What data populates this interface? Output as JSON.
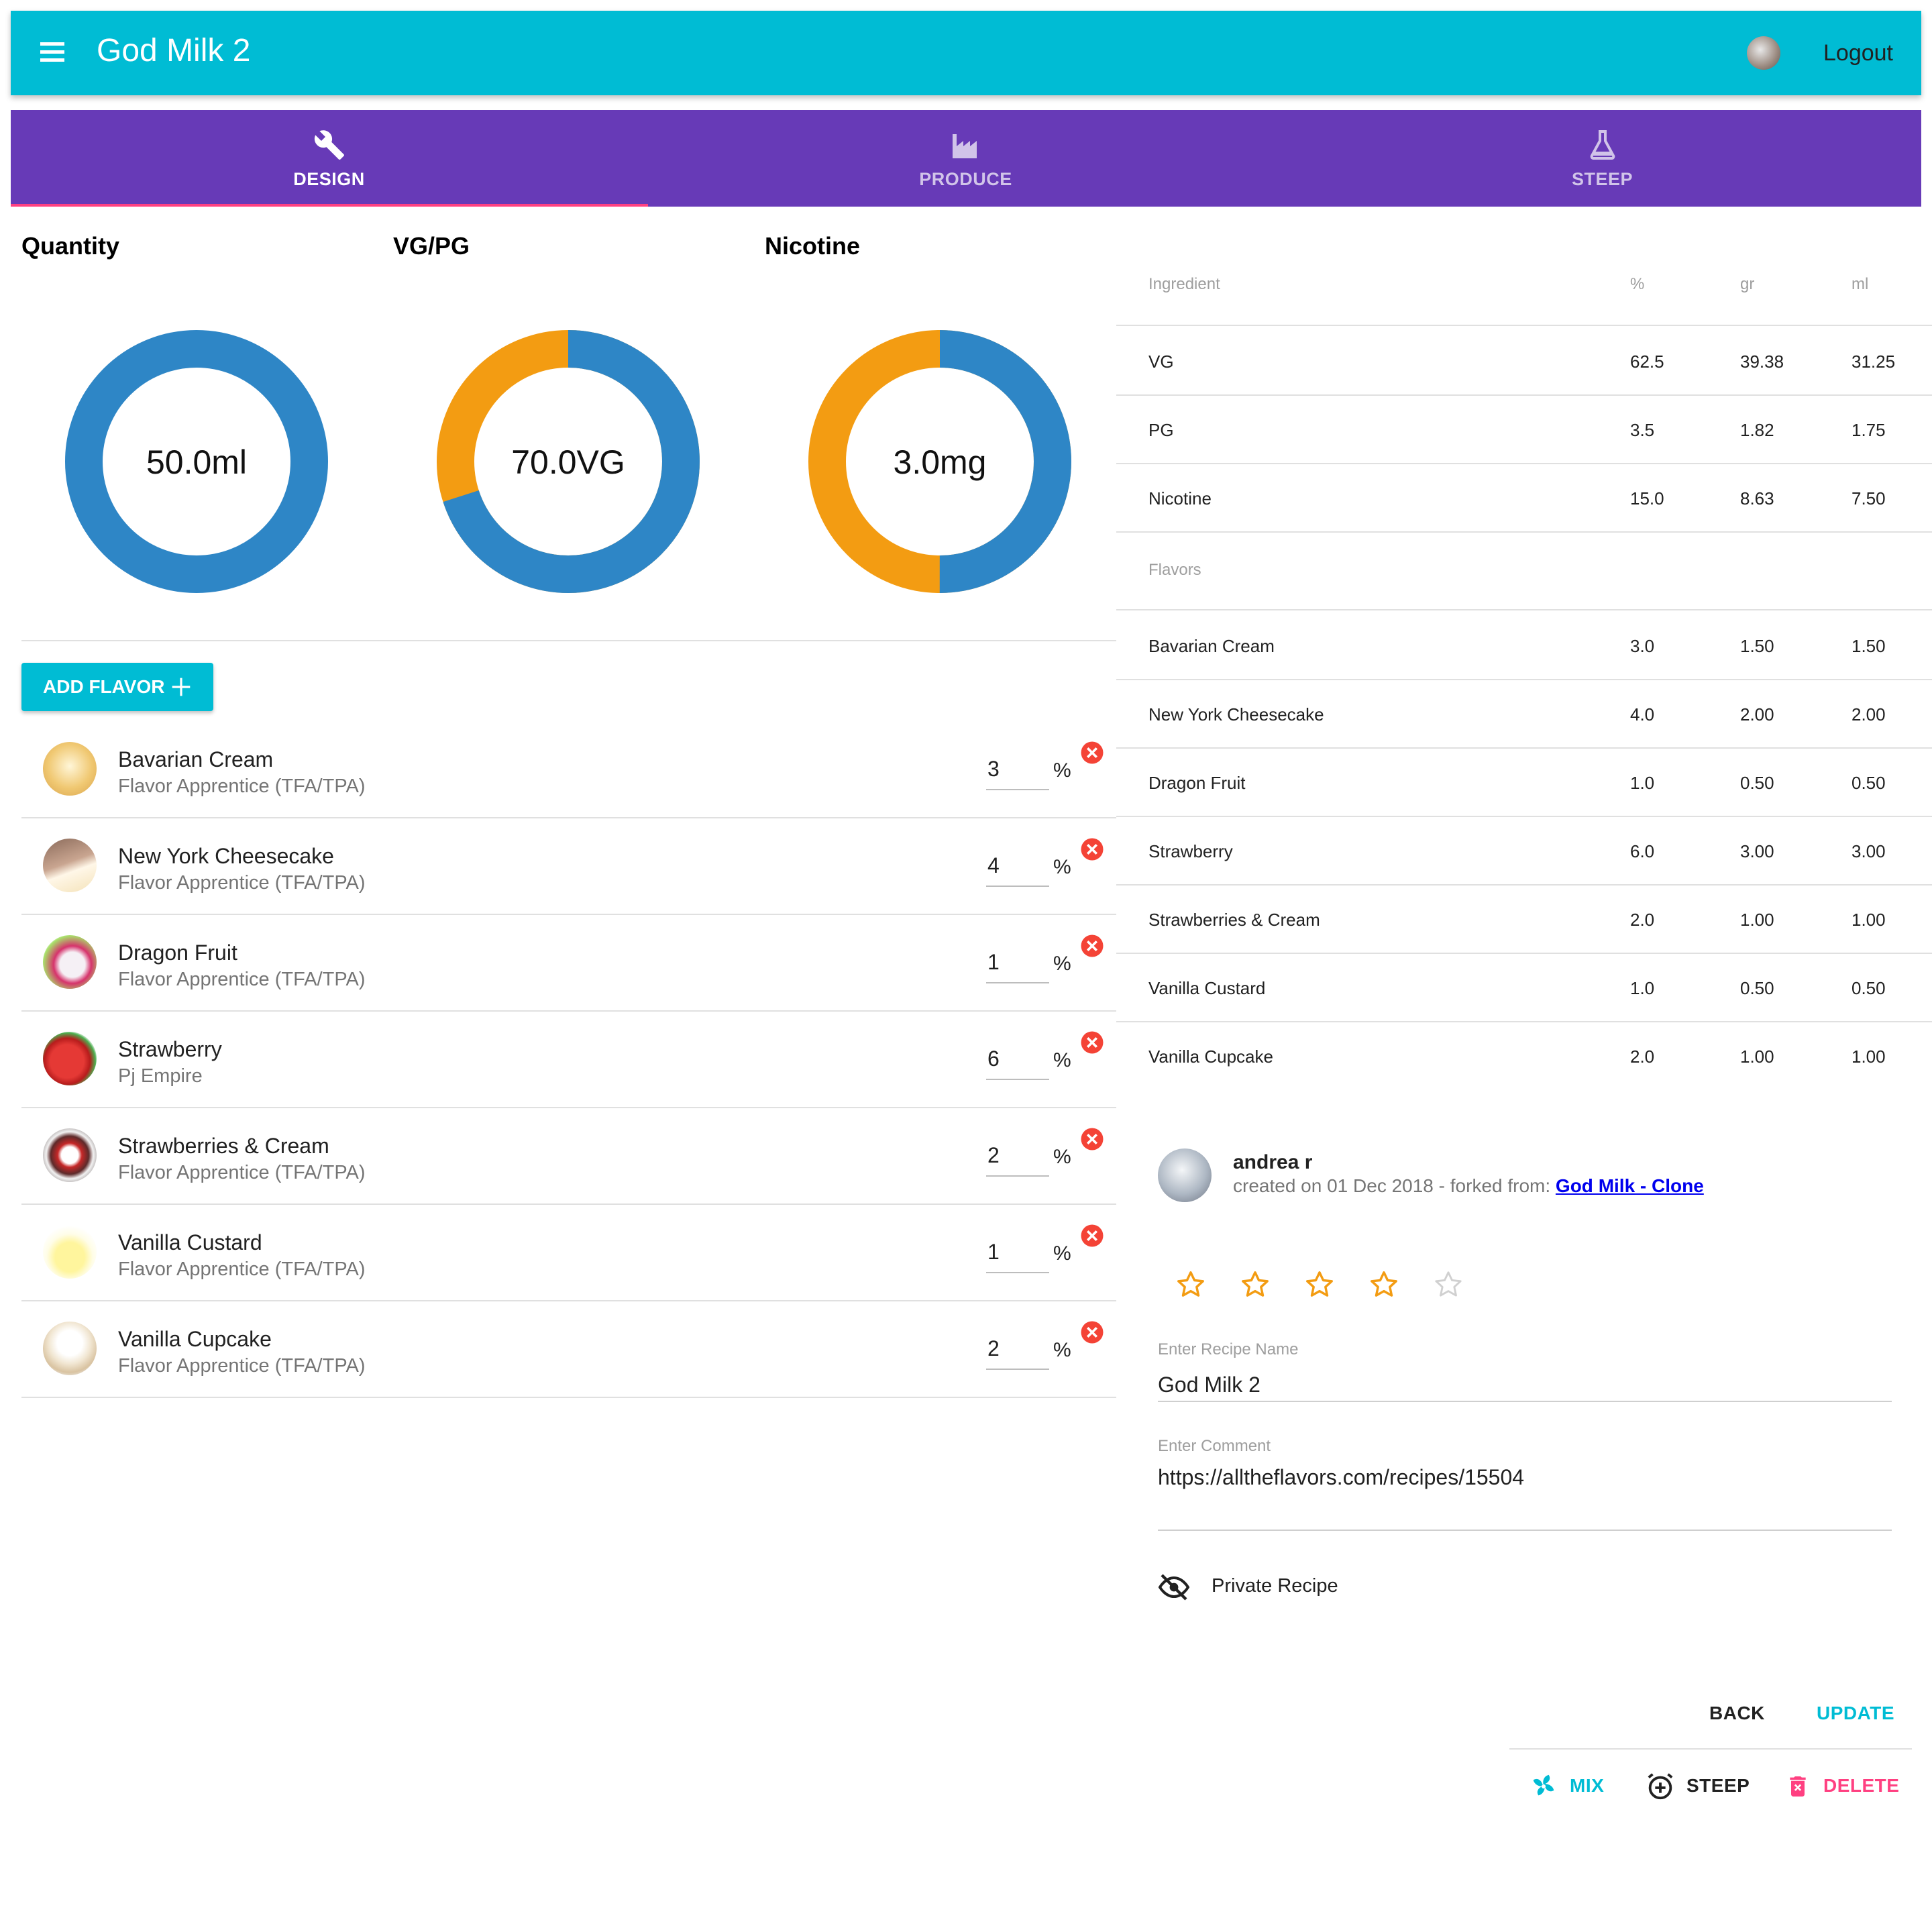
{
  "toolbar": {
    "title": "God Milk 2",
    "logout": "Logout",
    "menu_icon": "menu-icon",
    "avatar": "user-avatar"
  },
  "tabs": [
    {
      "label": "DESIGN",
      "icon": "wrench-icon",
      "active": true
    },
    {
      "label": "PRODUCE",
      "icon": "factory-icon",
      "active": false
    },
    {
      "label": "STEEP",
      "icon": "flask-icon",
      "active": false
    }
  ],
  "gauges": [
    {
      "title": "Quantity",
      "value": "50.0ml",
      "fraction": 1.0
    },
    {
      "title": "VG/PG",
      "value": "70.0VG",
      "fraction": 0.7
    },
    {
      "title": "Nicotine",
      "value": "3.0mg",
      "fraction": 0.5
    }
  ],
  "add_flavor": {
    "label": "ADD FLAVOR"
  },
  "flavors": [
    {
      "name": "Bavarian Cream",
      "maker": "Flavor Apprentice (TFA/TPA)",
      "percent": "3",
      "unit": "%"
    },
    {
      "name": "New York Cheesecake",
      "maker": "Flavor Apprentice (TFA/TPA)",
      "percent": "4",
      "unit": "%"
    },
    {
      "name": "Dragon Fruit",
      "maker": "Flavor Apprentice (TFA/TPA)",
      "percent": "1",
      "unit": "%"
    },
    {
      "name": "Strawberry",
      "maker": "Pj Empire",
      "percent": "6",
      "unit": "%"
    },
    {
      "name": "Strawberries & Cream",
      "maker": "Flavor Apprentice (TFA/TPA)",
      "percent": "2",
      "unit": "%"
    },
    {
      "name": "Vanilla Custard",
      "maker": "Flavor Apprentice (TFA/TPA)",
      "percent": "1",
      "unit": "%"
    },
    {
      "name": "Vanilla Cupcake",
      "maker": "Flavor Apprentice (TFA/TPA)",
      "percent": "2",
      "unit": "%"
    }
  ],
  "table": {
    "headers": [
      "Ingredient",
      "%",
      "gr",
      "ml"
    ],
    "base": [
      [
        "VG",
        "62.5",
        "39.38",
        "31.25"
      ],
      [
        "PG",
        "3.5",
        "1.82",
        "1.75"
      ],
      [
        "Nicotine",
        "15.0",
        "8.63",
        "7.50"
      ]
    ],
    "flavors_heading": "Flavors",
    "flavors": [
      [
        "Bavarian Cream",
        "3.0",
        "1.50",
        "1.50"
      ],
      [
        "New York Cheesecake",
        "4.0",
        "2.00",
        "2.00"
      ],
      [
        "Dragon Fruit",
        "1.0",
        "0.50",
        "0.50"
      ],
      [
        "Strawberry",
        "6.0",
        "3.00",
        "3.00"
      ],
      [
        "Strawberries & Cream",
        "2.0",
        "1.00",
        "1.00"
      ],
      [
        "Vanilla Custard",
        "1.0",
        "0.50",
        "0.50"
      ],
      [
        "Vanilla Cupcake",
        "2.0",
        "1.00",
        "1.00"
      ]
    ]
  },
  "author": {
    "name": "andrea r",
    "created_prefix": "created on 01 Dec 2018 - forked from: ",
    "forked_from": "God Milk - Clone"
  },
  "rating": {
    "value": 4,
    "max": 5
  },
  "recipe_name": {
    "label": "Enter Recipe Name",
    "value": "God Milk  2"
  },
  "comment": {
    "label": "Enter Comment",
    "value": "https://alltheflavors.com/recipes/15504"
  },
  "private": {
    "label": "Private Recipe",
    "icon": "eye-off-icon"
  },
  "actions": {
    "back": "BACK",
    "update": "UPDATE",
    "mix": "MIX",
    "steep": "STEEP",
    "delete": "DELETE"
  },
  "colors": {
    "toolbar": "#00bcd4",
    "tabs": "#673ab7",
    "tab_indicator": "#ff4081",
    "gauge_blue": "#2e86c6",
    "gauge_orange": "#f39c12",
    "accent_cyan": "#00bcd4",
    "delete_pink": "#ff4081",
    "remove_red": "#f44336",
    "star_orange": "#f39c12"
  }
}
